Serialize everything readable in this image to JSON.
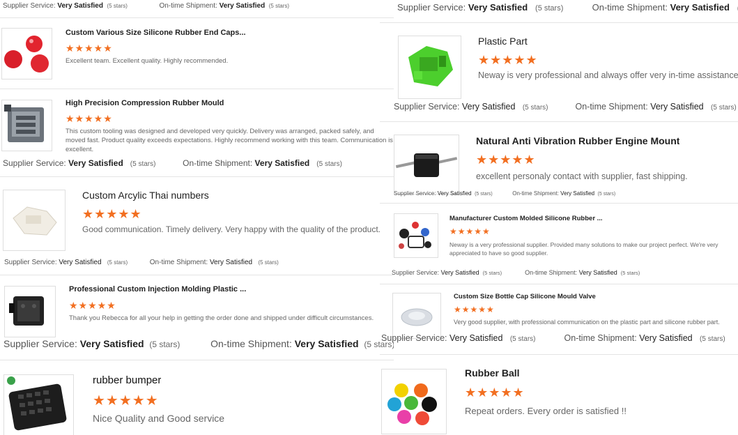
{
  "stars": "★★★★★",
  "labels": {
    "supplier_service": "Supplier Service:",
    "on_time_shipment": "On-time Shipment:",
    "very_satisfied": "Very Satisfied",
    "five_stars": "(5 stars)"
  },
  "left_reviews": [
    {
      "title": "Custom Various Size Silicone Rubber End Caps...",
      "comment": "Excellent team. Excellent quality. Highly recommended."
    },
    {
      "title": "High Precision Compression Rubber Mould",
      "comment": "This custom tooling was designed and developed very quickly. Delivery was arranged, packed safely, and moved fast. Product quality exceeds expectations. Highly recommend working with this team. Communication is excellent."
    },
    {
      "title": "Custom Arcylic Thai numbers",
      "comment": "Good communication. Timely delivery. Very happy with the quality of the product."
    },
    {
      "title": "Professional Custom Injection Molding Plastic ...",
      "comment": "Thank you Rebecca for all your help in getting the order done and shipped under difficult circumstances."
    },
    {
      "title": "rubber bumper",
      "comment": "Nice Quality and Good service"
    }
  ],
  "right_reviews": [
    {
      "title": "Plastic Part",
      "comment": "Neway is very professional and always offer very in-time assistance."
    },
    {
      "title": "Natural Anti Vibration Rubber Engine Mount",
      "comment": "excellent personaly contact with supplier, fast shipping."
    },
    {
      "title": "Manufacturer Custom Molded Silicone Rubber ...",
      "comment": "Neway is a very professional supplier. Provided many solutions to make our project perfect. We're very appreciated to have so good supplier."
    },
    {
      "title": "Custom Size Bottle Cap Silicone Mould Valve",
      "comment": "Very good supplier, with professional communication on the plastic part and silicone rubber part."
    },
    {
      "title": "Rubber Ball",
      "comment": "Repeat orders. Every order is satisfied !!"
    }
  ]
}
